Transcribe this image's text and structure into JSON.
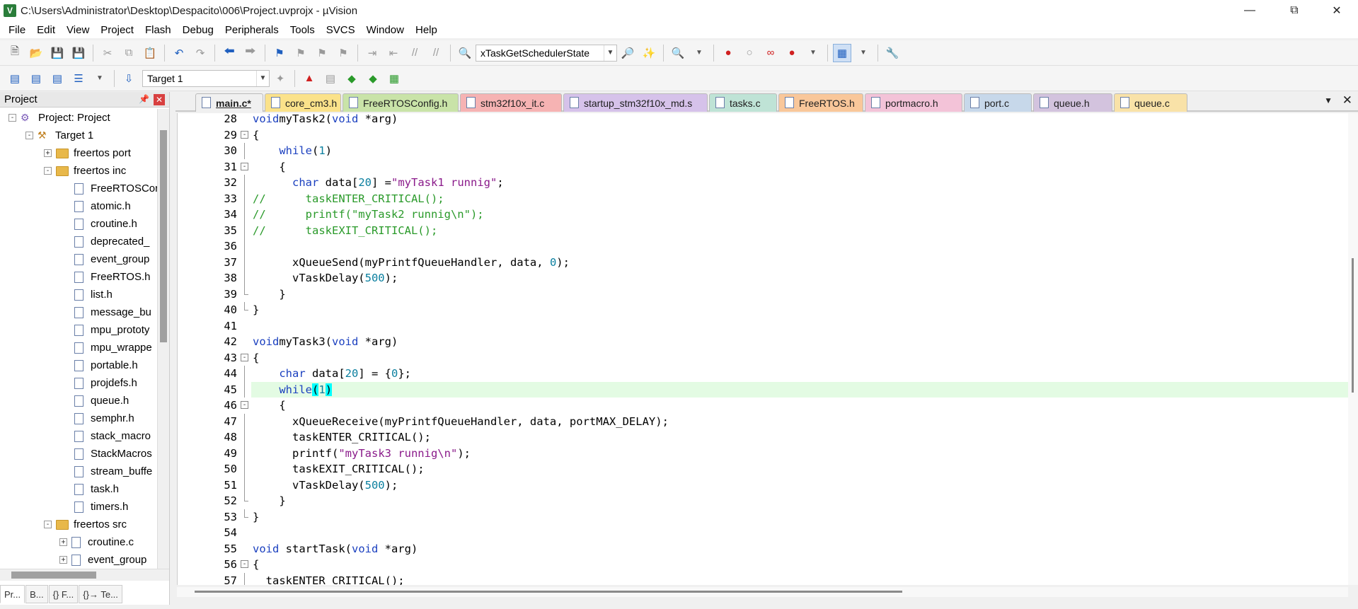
{
  "window": {
    "title": "C:\\Users\\Administrator\\Desktop\\Despacito\\006\\Project.uvprojx - µVision",
    "app_icon": "V"
  },
  "menu": [
    "File",
    "Edit",
    "View",
    "Project",
    "Flash",
    "Debug",
    "Peripherals",
    "Tools",
    "SVCS",
    "Window",
    "Help"
  ],
  "toolbar": {
    "function_combo": "xTaskGetSchedulerState",
    "target_combo": "Target 1"
  },
  "project_panel": {
    "title": "Project",
    "tree": [
      {
        "label": "Project: Project",
        "kind": "project",
        "depth": 0,
        "expander": "-"
      },
      {
        "label": "Target 1",
        "kind": "target",
        "depth": 1,
        "expander": "-"
      },
      {
        "label": "freertos port",
        "kind": "folder",
        "depth": 2,
        "expander": "+"
      },
      {
        "label": "freertos inc",
        "kind": "folder",
        "depth": 2,
        "expander": "-"
      },
      {
        "label": "FreeRTOSCor",
        "kind": "file",
        "depth": 3
      },
      {
        "label": "atomic.h",
        "kind": "file",
        "depth": 3
      },
      {
        "label": "croutine.h",
        "kind": "file",
        "depth": 3
      },
      {
        "label": "deprecated_",
        "kind": "file",
        "depth": 3
      },
      {
        "label": "event_group",
        "kind": "file",
        "depth": 3
      },
      {
        "label": "FreeRTOS.h",
        "kind": "file",
        "depth": 3
      },
      {
        "label": "list.h",
        "kind": "file",
        "depth": 3
      },
      {
        "label": "message_bu",
        "kind": "file",
        "depth": 3
      },
      {
        "label": "mpu_prototy",
        "kind": "file",
        "depth": 3
      },
      {
        "label": "mpu_wrappe",
        "kind": "file",
        "depth": 3
      },
      {
        "label": "portable.h",
        "kind": "file",
        "depth": 3
      },
      {
        "label": "projdefs.h",
        "kind": "file",
        "depth": 3
      },
      {
        "label": "queue.h",
        "kind": "file",
        "depth": 3
      },
      {
        "label": "semphr.h",
        "kind": "file",
        "depth": 3
      },
      {
        "label": "stack_macro",
        "kind": "file",
        "depth": 3
      },
      {
        "label": "StackMacros",
        "kind": "file",
        "depth": 3
      },
      {
        "label": "stream_buffe",
        "kind": "file",
        "depth": 3
      },
      {
        "label": "task.h",
        "kind": "file",
        "depth": 3
      },
      {
        "label": "timers.h",
        "kind": "file",
        "depth": 3
      },
      {
        "label": "freertos src",
        "kind": "folder",
        "depth": 2,
        "expander": "-"
      },
      {
        "label": "croutine.c",
        "kind": "file",
        "depth": 3,
        "expander": "+"
      },
      {
        "label": "event_group",
        "kind": "file",
        "depth": 3,
        "expander": "+"
      }
    ],
    "bottom_tabs": [
      "Pr...",
      "B...",
      "{} F...",
      "{}→ Te..."
    ]
  },
  "editor_tabs": [
    {
      "label": "main.c*",
      "color": "#f0f0f0",
      "active": true
    },
    {
      "label": "core_cm3.h",
      "color": "#fbe28a"
    },
    {
      "label": "FreeRTOSConfig.h",
      "color": "#c9e3a8"
    },
    {
      "label": "stm32f10x_it.c",
      "color": "#f6b3b3"
    },
    {
      "label": "startup_stm32f10x_md.s",
      "color": "#d6c2ea"
    },
    {
      "label": "tasks.c",
      "color": "#bfe3d6"
    },
    {
      "label": "FreeRTOS.h",
      "color": "#f9c79a"
    },
    {
      "label": "portmacro.h",
      "color": "#f3c3d8"
    },
    {
      "label": "port.c",
      "color": "#c7d8ea"
    },
    {
      "label": "queue.h",
      "color": "#d3c3de"
    },
    {
      "label": "queue.c",
      "color": "#f9e2a8"
    }
  ],
  "code": {
    "current_line": 45,
    "lines": [
      {
        "n": "28",
        "fold": "",
        "tokens": [
          [
            "kw",
            "void"
          ],
          [
            "",
            "myTask2("
          ],
          [
            "kw",
            "void"
          ],
          [
            "",
            " *arg)"
          ]
        ]
      },
      {
        "n": "29",
        "fold": "box",
        "tokens": [
          [
            "",
            "{"
          ]
        ]
      },
      {
        "n": "30",
        "fold": "line",
        "tokens": [
          [
            "",
            "    "
          ],
          [
            "kw",
            "while"
          ],
          [
            "",
            "("
          ],
          [
            "num",
            "1"
          ],
          [
            "",
            ")"
          ]
        ]
      },
      {
        "n": "31",
        "fold": "box",
        "tokens": [
          [
            "",
            "    {"
          ]
        ]
      },
      {
        "n": "32",
        "fold": "line",
        "tokens": [
          [
            "",
            "      "
          ],
          [
            "kw",
            "char"
          ],
          [
            "",
            " data["
          ],
          [
            "num",
            "20"
          ],
          [
            "",
            "] ="
          ],
          [
            "str",
            "\"myTask1 runnig\""
          ],
          [
            "",
            ";"
          ]
        ]
      },
      {
        "n": "33",
        "fold": "line",
        "tokens": [
          [
            "cmt",
            "//      taskENTER_CRITICAL();"
          ]
        ]
      },
      {
        "n": "34",
        "fold": "line",
        "tokens": [
          [
            "cmt",
            "//      printf(\"myTask2 runnig\\n\");"
          ]
        ]
      },
      {
        "n": "35",
        "fold": "line",
        "tokens": [
          [
            "cmt",
            "//      taskEXIT_CRITICAL();"
          ]
        ]
      },
      {
        "n": "36",
        "fold": "line",
        "tokens": [
          [
            "",
            ""
          ]
        ]
      },
      {
        "n": "37",
        "fold": "line",
        "tokens": [
          [
            "",
            "      xQueueSend(myPrintfQueueHandler, data, "
          ],
          [
            "num",
            "0"
          ],
          [
            "",
            ");"
          ]
        ]
      },
      {
        "n": "38",
        "fold": "line",
        "tokens": [
          [
            "",
            "      vTaskDelay("
          ],
          [
            "num",
            "500"
          ],
          [
            "",
            ");"
          ]
        ]
      },
      {
        "n": "39",
        "fold": "end",
        "tokens": [
          [
            "",
            "    }"
          ]
        ]
      },
      {
        "n": "40",
        "fold": "end",
        "tokens": [
          [
            "",
            "}"
          ]
        ]
      },
      {
        "n": "41",
        "fold": "",
        "tokens": [
          [
            "",
            ""
          ]
        ]
      },
      {
        "n": "42",
        "fold": "",
        "tokens": [
          [
            "kw",
            "void"
          ],
          [
            "",
            "myTask3("
          ],
          [
            "kw",
            "void"
          ],
          [
            "",
            " *arg)"
          ]
        ]
      },
      {
        "n": "43",
        "fold": "box",
        "tokens": [
          [
            "",
            "{"
          ]
        ]
      },
      {
        "n": "44",
        "fold": "line",
        "tokens": [
          [
            "",
            "    "
          ],
          [
            "kw",
            "char"
          ],
          [
            "",
            " data["
          ],
          [
            "num",
            "20"
          ],
          [
            "",
            "] = {"
          ],
          [
            "num",
            "0"
          ],
          [
            "",
            "};"
          ]
        ]
      },
      {
        "n": "45",
        "fold": "line",
        "tokens": [
          [
            "",
            "    "
          ],
          [
            "kw",
            "while"
          ],
          [
            "hl",
            "("
          ],
          [
            "num",
            "1"
          ],
          [
            "hl",
            ")"
          ]
        ]
      },
      {
        "n": "46",
        "fold": "box",
        "tokens": [
          [
            "",
            "    {"
          ]
        ]
      },
      {
        "n": "47",
        "fold": "line",
        "tokens": [
          [
            "",
            "      xQueueReceive(myPrintfQueueHandler, data, portMAX_DELAY);"
          ]
        ]
      },
      {
        "n": "48",
        "fold": "line",
        "tokens": [
          [
            "",
            "      taskENTER_CRITICAL();"
          ]
        ]
      },
      {
        "n": "49",
        "fold": "line",
        "tokens": [
          [
            "",
            "      printf("
          ],
          [
            "str",
            "\"myTask3 runnig\\n\""
          ],
          [
            "",
            ");"
          ]
        ]
      },
      {
        "n": "50",
        "fold": "line",
        "tokens": [
          [
            "",
            "      taskEXIT_CRITICAL();"
          ]
        ]
      },
      {
        "n": "51",
        "fold": "line",
        "tokens": [
          [
            "",
            "      vTaskDelay("
          ],
          [
            "num",
            "500"
          ],
          [
            "",
            ");"
          ]
        ]
      },
      {
        "n": "52",
        "fold": "end",
        "tokens": [
          [
            "",
            "    }"
          ]
        ]
      },
      {
        "n": "53",
        "fold": "end",
        "tokens": [
          [
            "",
            "}"
          ]
        ]
      },
      {
        "n": "54",
        "fold": "",
        "tokens": [
          [
            "",
            ""
          ]
        ]
      },
      {
        "n": "55",
        "fold": "",
        "tokens": [
          [
            "kw",
            "void"
          ],
          [
            "",
            " startTask("
          ],
          [
            "kw",
            "void"
          ],
          [
            "",
            " *arg)"
          ]
        ]
      },
      {
        "n": "56",
        "fold": "box",
        "tokens": [
          [
            "",
            "{"
          ]
        ]
      },
      {
        "n": "57",
        "fold": "line",
        "tokens": [
          [
            "",
            "  taskENTER_CRITICAL();"
          ]
        ]
      }
    ]
  }
}
